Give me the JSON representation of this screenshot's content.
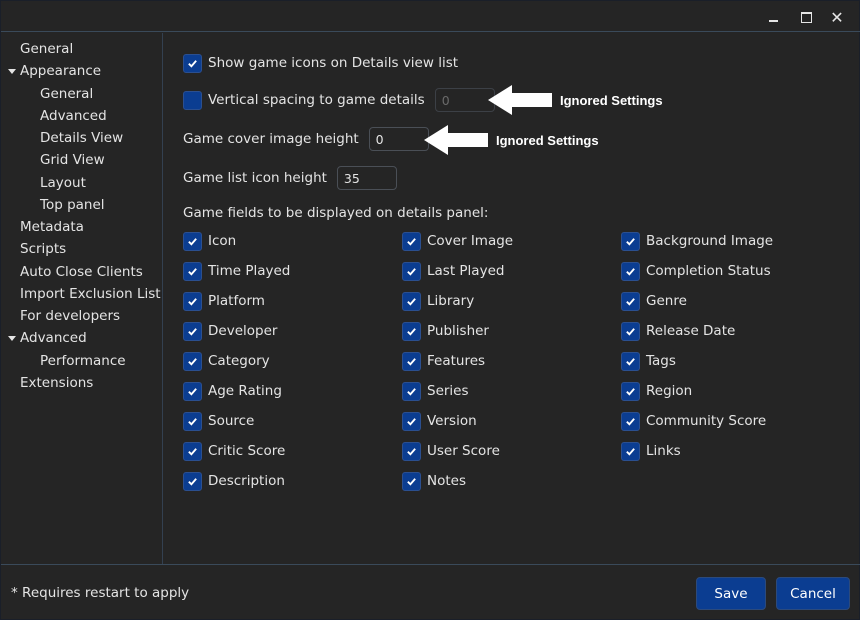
{
  "window": {
    "controls": {
      "minimize": "minimize-icon",
      "maximize": "maximize-icon",
      "close": "close-icon",
      "close_glyph": "✕"
    }
  },
  "sidebar": {
    "items": [
      {
        "label": "General",
        "level": 0,
        "expanded": null
      },
      {
        "label": "Appearance",
        "level": 0,
        "expanded": true
      },
      {
        "label": "General",
        "level": 1
      },
      {
        "label": "Advanced",
        "level": 1
      },
      {
        "label": "Details View",
        "level": 1,
        "selected": true
      },
      {
        "label": "Grid View",
        "level": 1
      },
      {
        "label": "Layout",
        "level": 1
      },
      {
        "label": "Top panel",
        "level": 1
      },
      {
        "label": "Metadata",
        "level": 0
      },
      {
        "label": "Scripts",
        "level": 0
      },
      {
        "label": "Auto Close Clients",
        "level": 0
      },
      {
        "label": "Import Exclusion List",
        "level": 0
      },
      {
        "label": "For developers",
        "level": 0
      },
      {
        "label": "Advanced",
        "level": 0,
        "expanded": true
      },
      {
        "label": "Performance",
        "level": 1
      },
      {
        "label": "Extensions",
        "level": 0
      }
    ]
  },
  "settings": {
    "show_icons": {
      "label": "Show game icons on Details view list",
      "checked": true
    },
    "vertical_spacing": {
      "label": "Vertical spacing to game details",
      "checked": false,
      "value": "0"
    },
    "cover_height": {
      "label": "Game cover image height",
      "value": "0"
    },
    "icon_height": {
      "label": "Game list icon height",
      "value": "35"
    },
    "annotation_1": "Ignored Settings",
    "annotation_2": "Ignored Settings",
    "fields_title": "Game fields to be displayed on details panel:",
    "fields": [
      {
        "label": "Icon",
        "checked": true
      },
      {
        "label": "Cover Image",
        "checked": true
      },
      {
        "label": "Background Image",
        "checked": true
      },
      {
        "label": "Time Played",
        "checked": true
      },
      {
        "label": "Last Played",
        "checked": true
      },
      {
        "label": "Completion Status",
        "checked": true
      },
      {
        "label": "Platform",
        "checked": true
      },
      {
        "label": "Library",
        "checked": true
      },
      {
        "label": "Genre",
        "checked": true
      },
      {
        "label": "Developer",
        "checked": true
      },
      {
        "label": "Publisher",
        "checked": true
      },
      {
        "label": "Release Date",
        "checked": true
      },
      {
        "label": "Category",
        "checked": true
      },
      {
        "label": "Features",
        "checked": true
      },
      {
        "label": "Tags",
        "checked": true
      },
      {
        "label": "Age Rating",
        "checked": true
      },
      {
        "label": "Series",
        "checked": true
      },
      {
        "label": "Region",
        "checked": true
      },
      {
        "label": "Source",
        "checked": true
      },
      {
        "label": "Version",
        "checked": true
      },
      {
        "label": "Community Score",
        "checked": true
      },
      {
        "label": "Critic Score",
        "checked": true
      },
      {
        "label": "User Score",
        "checked": true
      },
      {
        "label": "Links",
        "checked": true
      },
      {
        "label": "Description",
        "checked": true
      },
      {
        "label": "Notes",
        "checked": true
      }
    ]
  },
  "footer": {
    "note": "* Requires restart to apply",
    "save_label": "Save",
    "cancel_label": "Cancel"
  },
  "colors": {
    "background": "#252525",
    "accent": "#0b3d91",
    "text": "#e4e4e4",
    "divider": "#3a4a5a"
  }
}
